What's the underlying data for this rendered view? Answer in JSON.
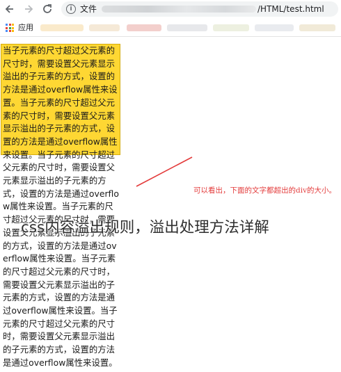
{
  "browser": {
    "back_icon": "back-arrow-icon",
    "forward_icon": "forward-arrow-icon",
    "reload_icon": "reload-icon",
    "info_icon": "info-circle-icon",
    "address_scheme": "文件",
    "address_path": "/HTML/test.html",
    "bookmarks": {
      "apps_label": "应用"
    }
  },
  "page": {
    "paragraph": "当子元素的尺寸超过父元素的尺寸时，需要设置父元素显示溢出的子元素的方式，设置的方法是通过overflow属性来设置。当子元素的尺寸超过父元素的尺寸时，需要设置父元素显示溢出的子元素的方式，设置的方法是通过overflow属性来设置。当子元素的尺寸超过父元素的尺寸时，需要设置父元素显示溢出的子元素的方式，设置的方法是通过overflow属性来设置。当子元素的尺寸超过父元素的尺寸时，需要设置父元素显示溢出的子元素的方式，设置的方法是通过overflow属性来设置。当子元素的尺寸超过父元素的尺寸时，需要设置父元素显示溢出的子元素的方式，设置的方法是通过overflow属性来设置。当子元素的尺寸超过父元素的尺寸时，需要设置父元素显示溢出的子元素的方式，设置的方法是通过overflow属性来设置。",
    "annotation": "可以看出，下面的文字都超出的div的大小。",
    "overlay_title": "css内容溢出规则，溢出处理方法详解"
  },
  "colors": {
    "box_background": "#fed733",
    "annotation": "#e33b3b",
    "address_bar": "#f1f3f4"
  }
}
